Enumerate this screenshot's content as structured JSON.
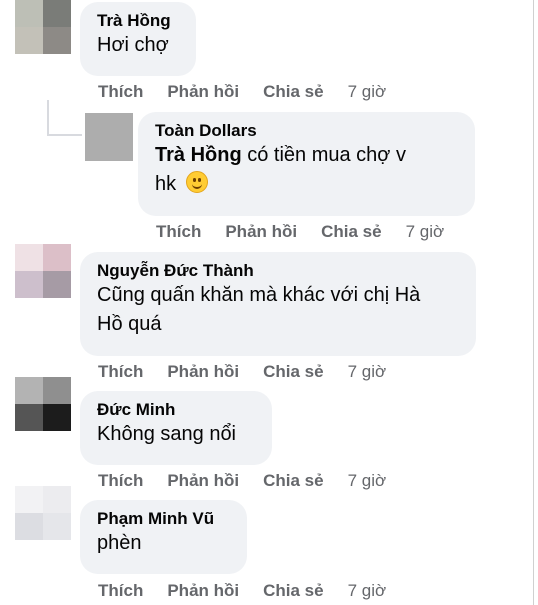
{
  "comments": [
    {
      "author": "Trà Hồng",
      "text": "Hơi chợ",
      "actions": {
        "like": "Thích",
        "reply": "Phản hồi",
        "share": "Chia sẻ",
        "time": "7 giờ"
      }
    },
    {
      "author": "Toàn Dollars",
      "mention": "Trà Hồng",
      "text_line1": " có tiền mua chợ v",
      "text_line2": "hk",
      "emoji": "smiling-face-emoji",
      "actions": {
        "like": "Thích",
        "reply": "Phản hồi",
        "share": "Chia sẻ",
        "time": "7 giờ"
      }
    },
    {
      "author": "Nguyễn Đức Thành",
      "text_line1": "Cũng quấn khăn mà khác với chị Hà",
      "text_line2": "Hồ quá",
      "actions": {
        "like": "Thích",
        "reply": "Phản hồi",
        "share": "Chia sẻ",
        "time": "7 giờ"
      }
    },
    {
      "author": "Đức Minh",
      "text": "Không sang nổi",
      "actions": {
        "like": "Thích",
        "reply": "Phản hồi",
        "share": "Chia sẻ",
        "time": "7 giờ"
      }
    },
    {
      "author": "Phạm Minh Vũ",
      "text": "phèn",
      "actions": {
        "like": "Thích",
        "reply": "Phản hồi",
        "share": "Chia sẻ",
        "time": "7 giờ"
      }
    }
  ],
  "colors": {
    "bubble": "#f0f2f5",
    "author": "#050505",
    "meta": "#65676b"
  }
}
